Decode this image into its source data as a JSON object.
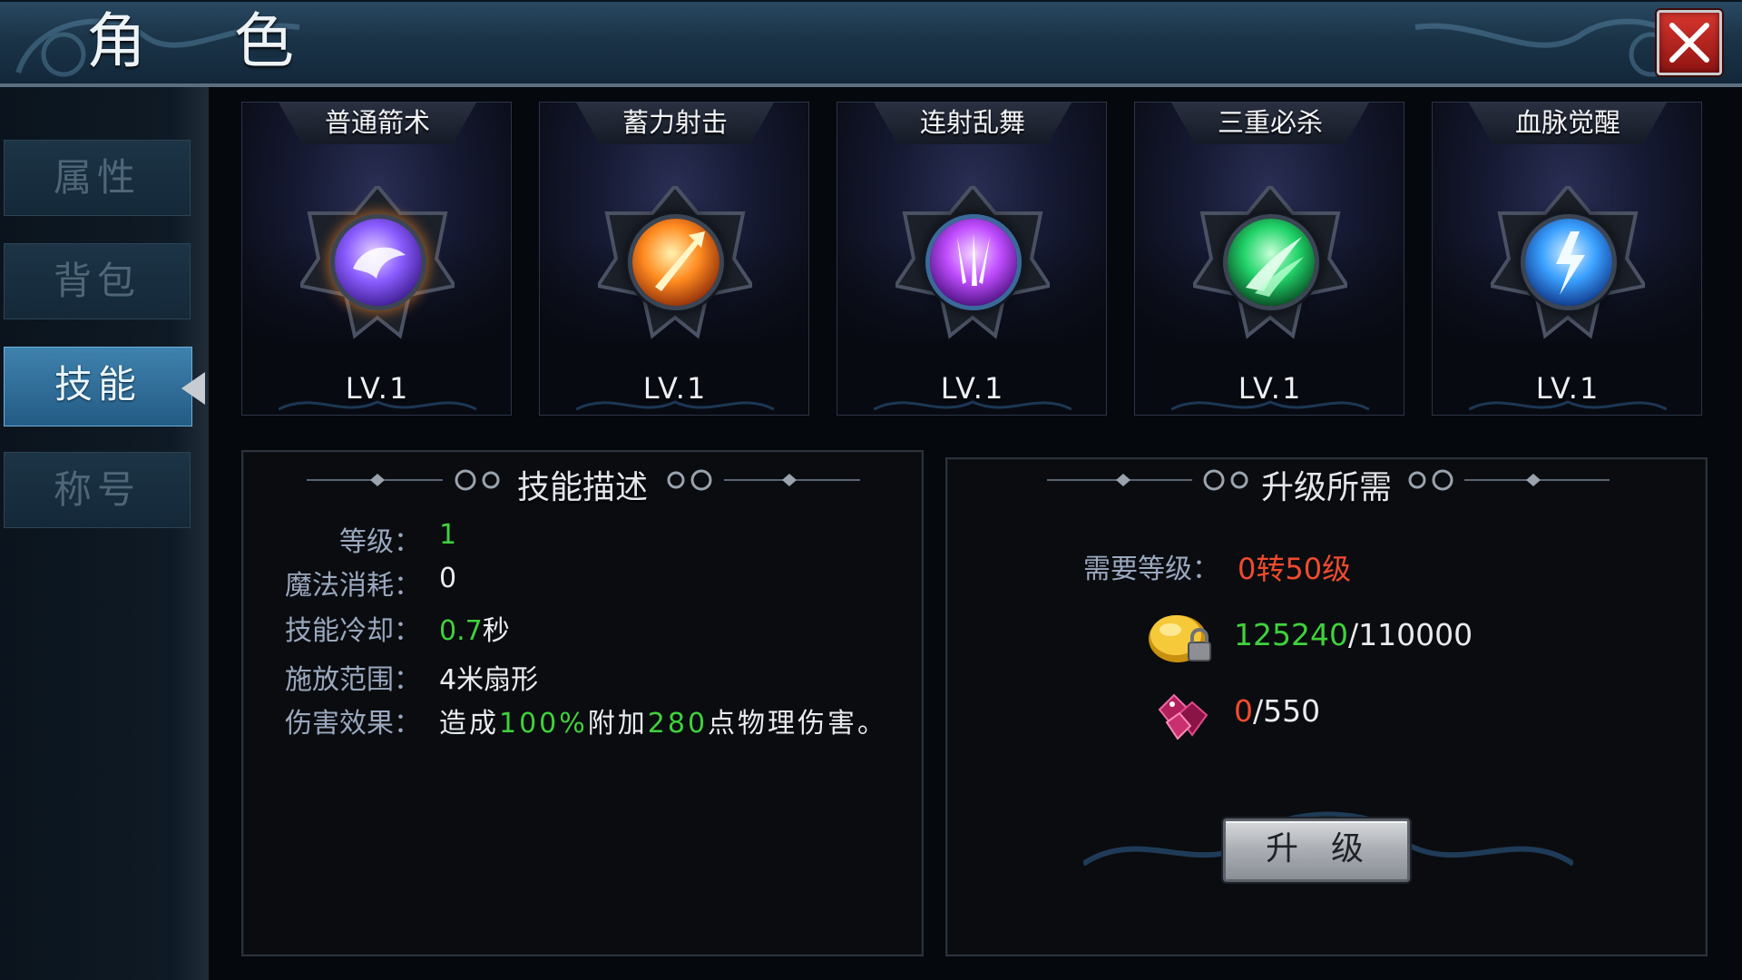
{
  "header": {
    "title": "角 色"
  },
  "sidebar": {
    "tabs": [
      {
        "label": "属性",
        "active": false
      },
      {
        "label": "背包",
        "active": false
      },
      {
        "label": "技能",
        "active": true
      },
      {
        "label": "称号",
        "active": false
      }
    ]
  },
  "skills": [
    {
      "name": "普通箭术",
      "level": "LV.1",
      "icon": "purple-dragon-icon",
      "color": "#8a5cff"
    },
    {
      "name": "蓄力射击",
      "level": "LV.1",
      "icon": "fire-arrow-icon",
      "color": "#ff8a1f"
    },
    {
      "name": "连射乱舞",
      "level": "LV.1",
      "icon": "multi-arrow-icon",
      "color": "#c04dff"
    },
    {
      "name": "三重必杀",
      "level": "LV.1",
      "icon": "green-slash-icon",
      "color": "#22d46a"
    },
    {
      "name": "血脉觉醒",
      "level": "LV.1",
      "icon": "lightning-icon",
      "color": "#3aa0ff"
    }
  ],
  "description": {
    "title": "技能描述",
    "level_label": "等级：",
    "level_value": "1",
    "mana_label": "魔法消耗：",
    "mana_value": "0",
    "cooldown_label": "技能冷却：",
    "cooldown_value": "0.7",
    "cooldown_unit": "秒",
    "range_label": "施放范围：",
    "range_value": "4米扇形",
    "effect_label": "伤害效果：",
    "effect_pre": "造成",
    "effect_pct": "100%",
    "effect_mid": "附加",
    "effect_num": "280",
    "effect_post": "点物理伤害。"
  },
  "requirements": {
    "title": "升级所需",
    "level_label": "需要等级：",
    "level_value": "0转50级",
    "gold_have": "125240",
    "gold_need": "/110000",
    "gem_have": "0",
    "gem_need": "/550",
    "gold_icon": "gold-coin-lock-icon",
    "gem_icon": "red-gem-icon",
    "upgrade_label": "升级"
  },
  "colors": {
    "accent_green": "#3fd23c",
    "accent_red": "#f04b2e",
    "active_tab": "#3f82ae"
  }
}
